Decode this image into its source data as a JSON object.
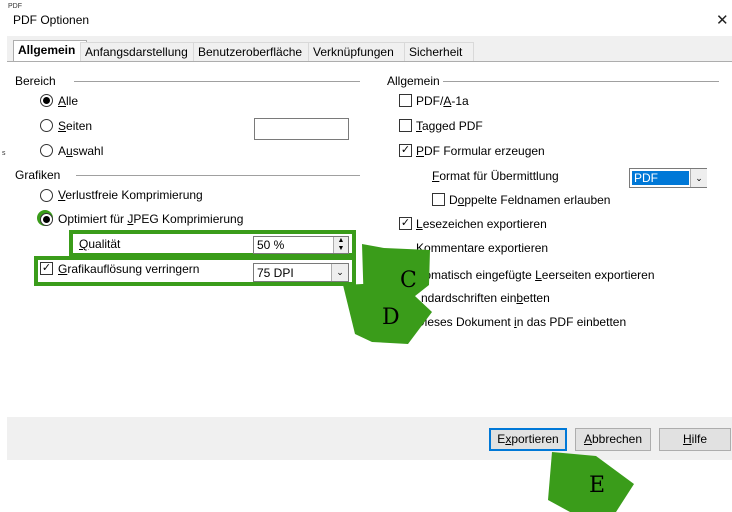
{
  "window": {
    "title": "PDF Optionen",
    "fragment_top": "PDF",
    "fragment_left": "s"
  },
  "tabs": [
    {
      "label": "Allgemein"
    },
    {
      "label": "Anfangsdarstellung"
    },
    {
      "label": "Benutzeroberfläche"
    },
    {
      "label": "Verknüpfungen"
    },
    {
      "label": "Sicherheit"
    }
  ],
  "left": {
    "bereich": {
      "heading": "Bereich",
      "options": [
        {
          "key": "A",
          "rest": "lle"
        },
        {
          "key": "S",
          "rest": "eiten"
        },
        {
          "pre": "A",
          "key": "u",
          "rest": "swahl"
        }
      ],
      "seiten_value": ""
    },
    "grafiken": {
      "heading": "Grafiken",
      "lossless": {
        "key": "V",
        "rest": "erlustfreie Komprimierung"
      },
      "jpeg": {
        "pre": "Optimiert für ",
        "key": "J",
        "rest": "PEG Komprimierung"
      },
      "quality": {
        "key": "Q",
        "rest": "ualität",
        "value": "50 %"
      },
      "reduce": {
        "key": "G",
        "rest": "rafikauflösung verringern",
        "value": "75 DPI"
      }
    }
  },
  "right": {
    "heading": "Allgemein",
    "pdfa": {
      "pre": "PDF/",
      "key": "A",
      "rest": "-1a"
    },
    "tagged": {
      "key": "T",
      "rest": "agged PDF"
    },
    "formular": {
      "key": "P",
      "rest": "DF Formular erzeugen"
    },
    "format": {
      "key": "F",
      "rest": "ormat für Übermittlung",
      "value": "PDF"
    },
    "doppelte": {
      "pre": "D",
      "key": "o",
      "rest": "ppelte Feldnamen erlauben"
    },
    "lesezeichen": {
      "key": "L",
      "rest": "esezeichen exportieren"
    },
    "kommentare": {
      "key": "K",
      "rest": "ommentare exportieren"
    },
    "leerseiten": {
      "pre": "tomatisch eingefügte ",
      "key": "L",
      "rest": "eerseiten exportieren"
    },
    "standard": {
      "pre": "ndardschriften ein",
      "key": "b",
      "rest": "etten"
    },
    "einbetten": {
      "pre": "Dieses Dokument ",
      "key": "i",
      "rest": "n das PDF einbetten"
    }
  },
  "buttons": {
    "export": {
      "pre": "E",
      "key": "x",
      "rest": "portieren"
    },
    "cancel": {
      "key": "A",
      "rest": "bbrechen"
    },
    "help": {
      "key": "H",
      "rest": "ilfe"
    }
  },
  "annotations": {
    "c": "C",
    "d": "D",
    "e": "E",
    "color": "#3a9c1a"
  },
  "icons": [
    "close-icon",
    "spin-up-icon",
    "spin-down-icon",
    "chevron-down-icon",
    "checkmark-icon"
  ]
}
